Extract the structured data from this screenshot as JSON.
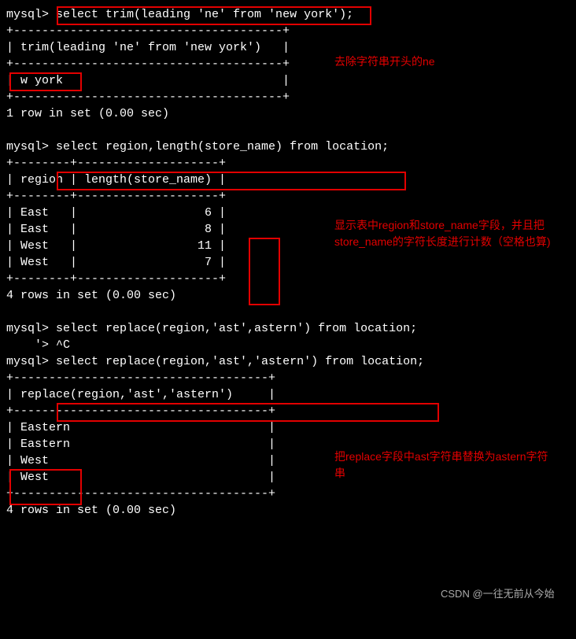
{
  "prompt": "mysql> ",
  "cmd1": "select trim(leading 'ne' from 'new york');",
  "sep1a": "+--------------------------------------+",
  "header1": "| trim(leading 'ne' from 'new york')   |",
  "sep1b": "+--------------------------------------+",
  "result1": "| w york                               |",
  "sep1c": "+--------------------------------------+",
  "rows1": "1 row in set (0.00 sec)",
  "blank": " ",
  "cmd2": "select region,length(store_name) from location;",
  "sep2a": "+--------+--------------------+",
  "header2": "| region | length(store_name) |",
  "sep2b": "+--------+--------------------+",
  "r2a": "| East   |                  6 |",
  "r2b": "| East   |                  8 |",
  "r2c": "| West   |                 11 |",
  "r2d": "| West   |                  7 |",
  "sep2c": "+--------+--------------------+",
  "rows2": "4 rows in set (0.00 sec)",
  "cmd3a": "select replace(region,'ast',astern') from location;",
  "cmd3b": "    '> ^C",
  "cmd4": "select replace(region,'ast','astern') from location;",
  "sep4a": "+------------------------------------+",
  "header4": "| replace(region,'ast','astern')     |",
  "sep4b": "+------------------------------------+",
  "r4a": "| Eastern                            |",
  "r4b": "| Eastern                            |",
  "r4c": "| West                               |",
  "r4d": "| West                               |",
  "sep4c": "+------------------------------------+",
  "rows4": "4 rows in set (0.00 sec)",
  "ann1": "去除字符串开头的ne",
  "ann2": "显示表中region和store_name字段，并且把store_name的字符长度进行计数（空格也算)",
  "ann3": "把replace字段中ast字符串替换为astern字符串",
  "watermark": "CSDN @一往无前从今始",
  "chart_data": {
    "type": "table",
    "queries": [
      {
        "sql": "select trim(leading 'ne' from 'new york');",
        "columns": [
          "trim(leading 'ne' from 'new york')"
        ],
        "rows": [
          [
            "w york"
          ]
        ],
        "row_count": 1,
        "time": "0.00 sec"
      },
      {
        "sql": "select region,length(store_name) from location;",
        "columns": [
          "region",
          "length(store_name)"
        ],
        "rows": [
          [
            "East",
            6
          ],
          [
            "East",
            8
          ],
          [
            "West",
            11
          ],
          [
            "West",
            7
          ]
        ],
        "row_count": 4,
        "time": "0.00 sec"
      },
      {
        "sql": "select replace(region,'ast','astern') from location;",
        "columns": [
          "replace(region,'ast','astern')"
        ],
        "rows": [
          [
            "Eastern"
          ],
          [
            "Eastern"
          ],
          [
            "West"
          ],
          [
            "West"
          ]
        ],
        "row_count": 4,
        "time": "0.00 sec"
      }
    ]
  }
}
